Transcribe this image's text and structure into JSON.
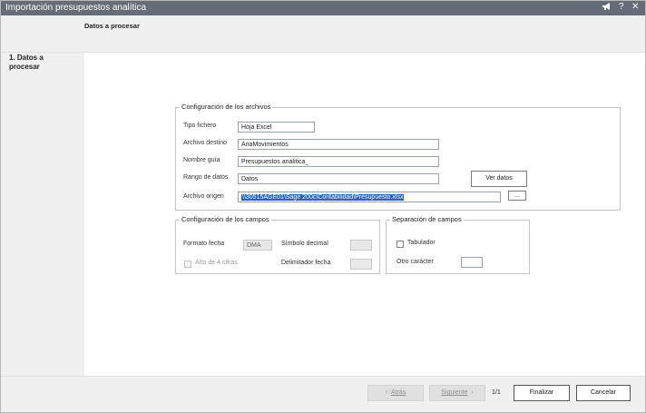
{
  "window": {
    "title": "Importación presupuestos analítica",
    "controls": [
      "megaphone-icon",
      "help-icon",
      "close-icon"
    ]
  },
  "header": {
    "step_title": "Datos a procesar"
  },
  "steps": [
    {
      "label": "1. Datos a procesar",
      "active": true
    }
  ],
  "config_archivos": {
    "legend": "Configuración de los archivos",
    "tipo_fichero": {
      "label": "Tipo fichero",
      "value": "Hoja Excel"
    },
    "archivo_destino": {
      "label": "Archivo destino",
      "value": "AnaMovimientos"
    },
    "nombre_guia": {
      "label": "Nombre guía",
      "value": "Presupuestos analitica_"
    },
    "rango_datos": {
      "label": "Rango de datos",
      "value": "Datos"
    },
    "ver_datos_button": "Ver datos",
    "archivo_origen": {
      "label": "Archivo origen",
      "value": "\\\\30515AGE01\\Sage 200c\\Contabilidad\\Presupuesto.xlsx"
    },
    "browse_button": "..."
  },
  "config_campos": {
    "legend": "Configuración de los campos",
    "formato_fecha": {
      "label": "Formato fecha",
      "value": "DMA"
    },
    "simbolo_decimal": {
      "label": "Símbolo decimal",
      "value": ""
    },
    "anio_4_cifras": {
      "label": "Año de 4 cifras",
      "checked": false,
      "enabled": false
    },
    "delimitador_fecha": {
      "label": "Delimitador fecha",
      "value": ""
    }
  },
  "separacion": {
    "legend": "Separación de campos",
    "tabulador": {
      "label": "Tabulador",
      "checked": false
    },
    "otro_caracter": {
      "label": "Otro carácter",
      "value": ""
    }
  },
  "footer": {
    "atras": "Atrás",
    "siguiente": "Siguiente",
    "page": "1/1",
    "finalizar": "Finalizar",
    "cancelar": "Cancelar"
  },
  "colors": {
    "titlebar": "#666c78",
    "selection": "#1e63c8",
    "panel": "#f0f0f0"
  }
}
